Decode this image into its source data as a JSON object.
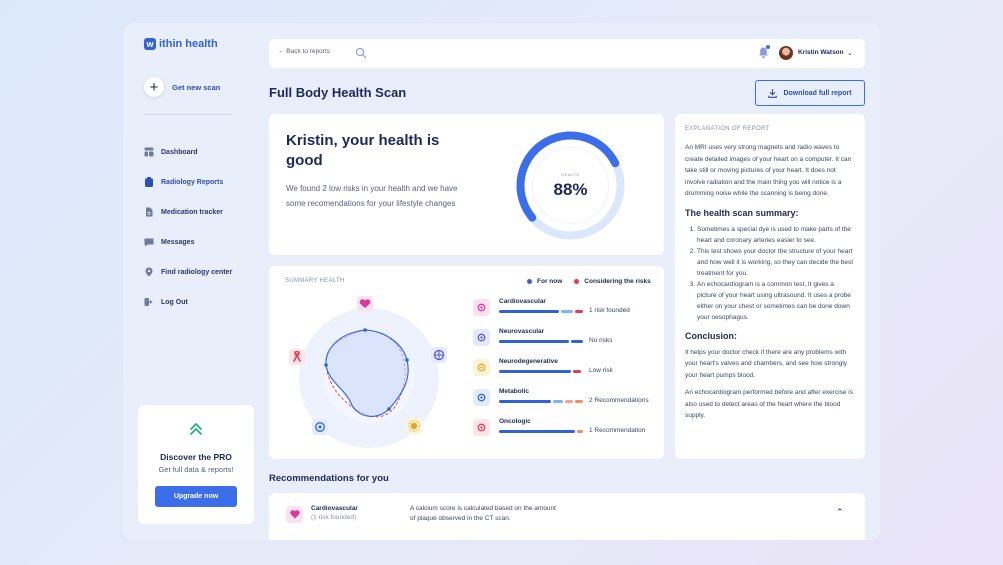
{
  "brand": {
    "logo_letter": "w",
    "name": "ithin health",
    "accent": "#3361d6"
  },
  "sidebar": {
    "new_scan": "Get new scan",
    "items": [
      {
        "label": "Dashboard",
        "icon": "dashboard-icon"
      },
      {
        "label": "Radiology Reports",
        "icon": "clipboard-icon",
        "active": true
      },
      {
        "label": "Medication tracker",
        "icon": "document-icon"
      },
      {
        "label": "Messages",
        "icon": "message-icon"
      },
      {
        "label": "Find radiology center",
        "icon": "location-pin-icon"
      },
      {
        "label": "Log Out",
        "icon": "logout-icon"
      }
    ],
    "pro": {
      "title": "Discover the PRO",
      "subtitle": "Get full data & reports!",
      "button": "Upgrade now"
    }
  },
  "topbar": {
    "back": "← Back to reports",
    "user_name": "Kristin Watson"
  },
  "page": {
    "title": "Full Body Health Scan",
    "download": "Download full report"
  },
  "hero": {
    "title": "Kristin, your health is good",
    "description": "We found 2 low risks in your health and we have some recomendations for your lifestyle changes",
    "gauge_label": "HEALTH",
    "gauge_value": "88%",
    "gauge_fraction": 0.88
  },
  "summary": {
    "title": "SUMMARY HEALTH",
    "legend": [
      {
        "label": "For now",
        "color": "#2f63d6"
      },
      {
        "label": "Considering the risks",
        "color": "#e8394f"
      }
    ],
    "risks": [
      {
        "name": "Cardiovascular",
        "status": "1 risk founded",
        "icon": "heart-icon",
        "bg": "#fbe2f1",
        "fg": "#d63a9a"
      },
      {
        "name": "Neurovascular",
        "status": "No risks",
        "icon": "brain-icon",
        "bg": "#e6e8fb",
        "fg": "#5558c8"
      },
      {
        "name": "Neurodegenerative",
        "status": "Low risk",
        "icon": "sun-icon",
        "bg": "#fdf3d9",
        "fg": "#e0a81c"
      },
      {
        "name": "Metabolic",
        "status": "2 Recommendations",
        "icon": "metabolic-icon",
        "bg": "#e3ecfc",
        "fg": "#2f63d6"
      },
      {
        "name": "Oncologic",
        "status": "1 Recommendation",
        "icon": "ribbon-icon",
        "bg": "#fde4e6",
        "fg": "#e8394f"
      }
    ]
  },
  "explanation": {
    "heading": "EXPLANATION OF REPORT",
    "intro": "An MRI uses very strong magnets and radio waves to create detailed images of your heart on a computer. It can take still or moving pictures of your heart. It does not involve radiation and the main thing you will notice is a drumming noise while the scanning is being done.",
    "summary_title": "The health scan summary:",
    "summary_items": [
      "Sometimes a special dye is used to make parts of the heart and coronary arteries easier to see.",
      "This test shows your doctor the structure of your heart and how well it is working, so they can decide the best treatment for you.",
      "An echocardiogram is a common test. It gives a picture of your heart using ultrasound. It uses a probe either on your chest or sometimes can be done down your oesophagus."
    ],
    "conclusion_title": "Conclusion:",
    "conclusion_1": "It helps your doctor check if there are any problems with your heart's valves and chambers, and see how strongly your heart pumps blood.",
    "conclusion_2": "An echocardiogram performed before and after exercise is also used to detect areas of the heart where the blood supply."
  },
  "recommendations": {
    "title": "Recommendations for you",
    "items": [
      {
        "name": "Cardiovascular",
        "sub": "(1 risk founded)",
        "text": "A calcium score is calculated based on the amount of plaque observed in the CT scan."
      }
    ]
  }
}
